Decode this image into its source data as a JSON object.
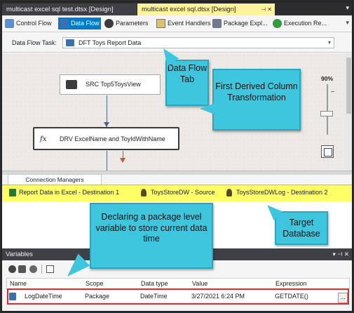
{
  "tabs": {
    "inactive": "multicast excel sql test.dtsx [Design]",
    "active": "multicast excel sql.dtsx [Design]",
    "active_icons": "⊣ ✕"
  },
  "toolbar": {
    "control_flow": "Control Flow",
    "data_flow": "Data Flow",
    "parameters": "Parameters",
    "event_handlers": "Event Handlers",
    "package_explorer": "Package Expl...",
    "execution_results": "Execution Re..."
  },
  "data_flow_task": {
    "label": "Data Flow Task:",
    "value": "DFT Toys Report Data"
  },
  "canvas": {
    "source_component": "SRC Top5ToysView",
    "derived_component": "DRV ExcelName and ToyIdWithName",
    "derived_icon_text": "fx",
    "zoom": "90%"
  },
  "connection_managers": {
    "tab_label": "Connection Managers",
    "items": [
      {
        "label": "Report Data in Excel  - Destination 1",
        "icon": "excel-icon"
      },
      {
        "label": "ToysStoreDW - Source",
        "icon": "database-icon"
      },
      {
        "label": "ToysStoreDWLog - Destination 2",
        "icon": "database-icon"
      }
    ]
  },
  "variables": {
    "title": "Variables",
    "pane_buttons": "▾ ⊣ ✕",
    "columns": [
      "Name",
      "Scope",
      "Data type",
      "Value",
      "Expression"
    ],
    "row": {
      "name": "LogDateTime",
      "scope": "Package",
      "data_type": "DateTime",
      "value": "3/27/2021 6:24 PM",
      "expression": "GETDATE()",
      "ellipsis": "..."
    }
  },
  "callouts": {
    "data_flow_tab": "Data Flow Tab",
    "first_derived": "First Derived Column Transformation",
    "target_db": "Target Database",
    "declaring_var": "Declaring a package level variable to store current data time"
  },
  "colors": {
    "callout": "#3ec6de",
    "active_tab": "#fff29d",
    "connection_bar": "#ffff66",
    "row_highlight": "#e0282e",
    "selected_toolbar": "#007acc"
  }
}
